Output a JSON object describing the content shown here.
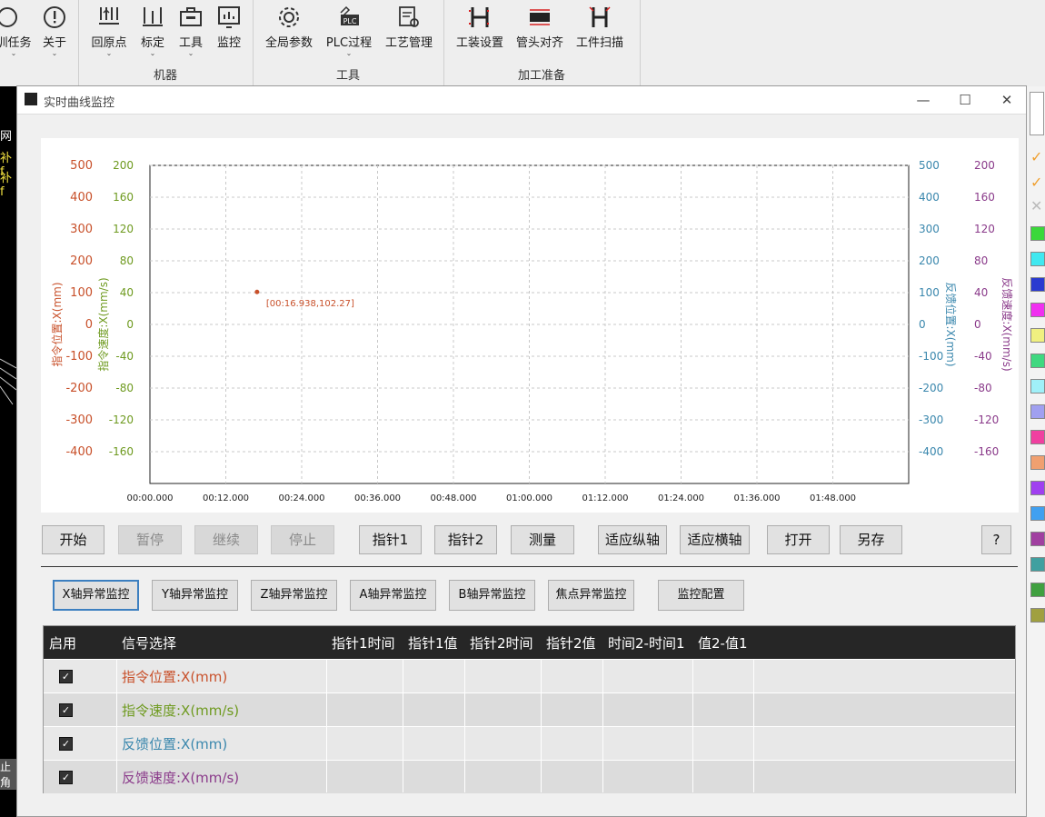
{
  "ribbon": {
    "partial_left": [
      "训任务"
    ],
    "about": "关于",
    "machine": {
      "label": "机器",
      "buttons": [
        "回原点",
        "标定",
        "工具",
        "监控"
      ]
    },
    "tools": {
      "label": "工具",
      "buttons": [
        "全局参数",
        "PLC过程",
        "工艺管理"
      ]
    },
    "prep": {
      "label": "加工准备",
      "buttons": [
        "工装设置",
        "管头对齐",
        "工件扫描"
      ]
    }
  },
  "left_strip": {
    "texts": [
      "网",
      "补 f",
      "补 f"
    ],
    "bottom": "止角"
  },
  "window": {
    "title": "实时曲线监控",
    "controls": {
      "minimize": "—",
      "maximize": "☐",
      "close": "✕"
    }
  },
  "colors": {
    "cmd_pos": "#c8502a",
    "cmd_vel": "#6e9a1f",
    "fb_pos": "#3a87ad",
    "fb_vel": "#8a3a8a",
    "tab_active": "#3c7fc0"
  },
  "chart_data": {
    "type": "line",
    "x_ticks": [
      "00:00.000",
      "00:12.000",
      "00:24.000",
      "00:36.000",
      "00:48.000",
      "01:00.000",
      "01:12.000",
      "01:24.000",
      "01:36.000",
      "01:48.000"
    ],
    "axes": {
      "left_outer": {
        "label": "指令位置:X(mm)",
        "ticks": [
          500,
          400,
          300,
          200,
          100,
          0,
          -100,
          -200,
          -300,
          -400
        ],
        "ylim": [
          -500,
          500
        ]
      },
      "left_inner": {
        "label": "指令速度:X(mm/s)",
        "ticks": [
          200,
          160,
          120,
          80,
          40,
          0,
          -40,
          -80,
          -120,
          -160
        ],
        "ylim": [
          -200,
          200
        ]
      },
      "right_inner": {
        "label": "反馈位置:X(mm)",
        "ticks": [
          500,
          400,
          300,
          200,
          100,
          0,
          -100,
          -200,
          -300,
          -400
        ],
        "ylim": [
          -500,
          500
        ]
      },
      "right_outer": {
        "label": "反馈速度:X(mm/s)",
        "ticks": [
          200,
          160,
          120,
          80,
          40,
          0,
          -40,
          -80,
          -120,
          -160
        ],
        "ylim": [
          -200,
          200
        ]
      }
    },
    "points": [
      {
        "x_sec": 16.938,
        "y": 102.27,
        "label": "[00:16.938,102.27]"
      }
    ],
    "xlim_sec": [
      0,
      120
    ],
    "grid": true
  },
  "controls": {
    "start": "开始",
    "pause": "暂停",
    "resume": "继续",
    "stop": "停止",
    "cursor1": "指针1",
    "cursor2": "指针2",
    "measure": "测量",
    "fit_y": "适应纵轴",
    "fit_x": "适应横轴",
    "open": "打开",
    "save_as": "另存",
    "help": "?"
  },
  "tabs": [
    "X轴异常监控",
    "Y轴异常监控",
    "Z轴异常监控",
    "A轴异常监控",
    "B轴异常监控",
    "焦点异常监控",
    "监控配置"
  ],
  "table": {
    "headers": [
      "启用",
      "信号选择",
      "指针1时间",
      "指针1值",
      "指针2时间",
      "指针2值",
      "时间2-时间1",
      "值2-值1"
    ],
    "rows": [
      {
        "enabled": true,
        "signal": "指令位置:X(mm)"
      },
      {
        "enabled": true,
        "signal": "指令速度:X(mm/s)"
      },
      {
        "enabled": true,
        "signal": "反馈位置:X(mm)"
      },
      {
        "enabled": true,
        "signal": "反馈速度:X(mm/s)"
      }
    ]
  }
}
